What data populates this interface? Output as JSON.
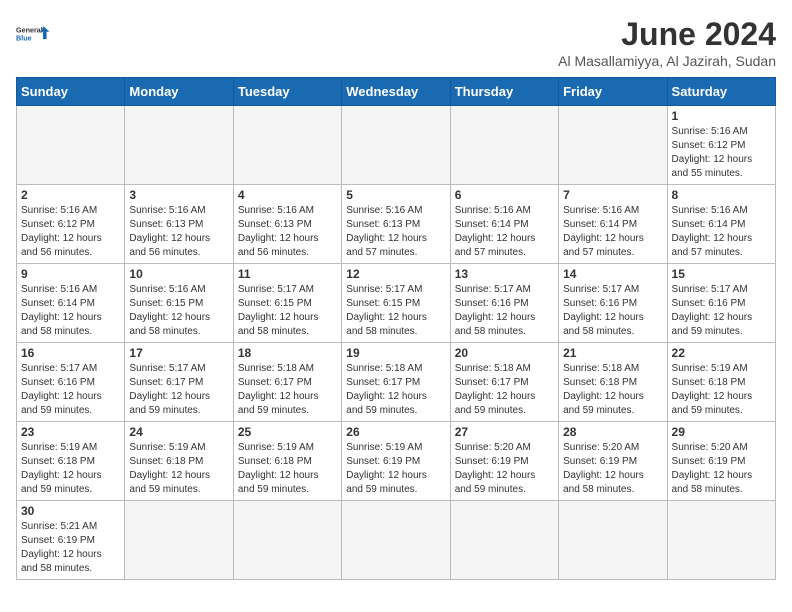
{
  "logo": {
    "line1": "General",
    "line2": "Blue"
  },
  "title": "June 2024",
  "subtitle": "Al Masallamiyya, Al Jazirah, Sudan",
  "weekdays": [
    "Sunday",
    "Monday",
    "Tuesday",
    "Wednesday",
    "Thursday",
    "Friday",
    "Saturday"
  ],
  "days": [
    {
      "date": 1,
      "col": 6,
      "sunrise": "5:16 AM",
      "sunset": "6:12 PM",
      "daylight": "12 hours and 55 minutes."
    },
    {
      "date": 2,
      "col": 0,
      "sunrise": "5:16 AM",
      "sunset": "6:12 PM",
      "daylight": "12 hours and 56 minutes."
    },
    {
      "date": 3,
      "col": 1,
      "sunrise": "5:16 AM",
      "sunset": "6:13 PM",
      "daylight": "12 hours and 56 minutes."
    },
    {
      "date": 4,
      "col": 2,
      "sunrise": "5:16 AM",
      "sunset": "6:13 PM",
      "daylight": "12 hours and 56 minutes."
    },
    {
      "date": 5,
      "col": 3,
      "sunrise": "5:16 AM",
      "sunset": "6:13 PM",
      "daylight": "12 hours and 57 minutes."
    },
    {
      "date": 6,
      "col": 4,
      "sunrise": "5:16 AM",
      "sunset": "6:14 PM",
      "daylight": "12 hours and 57 minutes."
    },
    {
      "date": 7,
      "col": 5,
      "sunrise": "5:16 AM",
      "sunset": "6:14 PM",
      "daylight": "12 hours and 57 minutes."
    },
    {
      "date": 8,
      "col": 6,
      "sunrise": "5:16 AM",
      "sunset": "6:14 PM",
      "daylight": "12 hours and 57 minutes."
    },
    {
      "date": 9,
      "col": 0,
      "sunrise": "5:16 AM",
      "sunset": "6:14 PM",
      "daylight": "12 hours and 58 minutes."
    },
    {
      "date": 10,
      "col": 1,
      "sunrise": "5:16 AM",
      "sunset": "6:15 PM",
      "daylight": "12 hours and 58 minutes."
    },
    {
      "date": 11,
      "col": 2,
      "sunrise": "5:17 AM",
      "sunset": "6:15 PM",
      "daylight": "12 hours and 58 minutes."
    },
    {
      "date": 12,
      "col": 3,
      "sunrise": "5:17 AM",
      "sunset": "6:15 PM",
      "daylight": "12 hours and 58 minutes."
    },
    {
      "date": 13,
      "col": 4,
      "sunrise": "5:17 AM",
      "sunset": "6:16 PM",
      "daylight": "12 hours and 58 minutes."
    },
    {
      "date": 14,
      "col": 5,
      "sunrise": "5:17 AM",
      "sunset": "6:16 PM",
      "daylight": "12 hours and 58 minutes."
    },
    {
      "date": 15,
      "col": 6,
      "sunrise": "5:17 AM",
      "sunset": "6:16 PM",
      "daylight": "12 hours and 59 minutes."
    },
    {
      "date": 16,
      "col": 0,
      "sunrise": "5:17 AM",
      "sunset": "6:16 PM",
      "daylight": "12 hours and 59 minutes."
    },
    {
      "date": 17,
      "col": 1,
      "sunrise": "5:17 AM",
      "sunset": "6:17 PM",
      "daylight": "12 hours and 59 minutes."
    },
    {
      "date": 18,
      "col": 2,
      "sunrise": "5:18 AM",
      "sunset": "6:17 PM",
      "daylight": "12 hours and 59 minutes."
    },
    {
      "date": 19,
      "col": 3,
      "sunrise": "5:18 AM",
      "sunset": "6:17 PM",
      "daylight": "12 hours and 59 minutes."
    },
    {
      "date": 20,
      "col": 4,
      "sunrise": "5:18 AM",
      "sunset": "6:17 PM",
      "daylight": "12 hours and 59 minutes."
    },
    {
      "date": 21,
      "col": 5,
      "sunrise": "5:18 AM",
      "sunset": "6:18 PM",
      "daylight": "12 hours and 59 minutes."
    },
    {
      "date": 22,
      "col": 6,
      "sunrise": "5:19 AM",
      "sunset": "6:18 PM",
      "daylight": "12 hours and 59 minutes."
    },
    {
      "date": 23,
      "col": 0,
      "sunrise": "5:19 AM",
      "sunset": "6:18 PM",
      "daylight": "12 hours and 59 minutes."
    },
    {
      "date": 24,
      "col": 1,
      "sunrise": "5:19 AM",
      "sunset": "6:18 PM",
      "daylight": "12 hours and 59 minutes."
    },
    {
      "date": 25,
      "col": 2,
      "sunrise": "5:19 AM",
      "sunset": "6:18 PM",
      "daylight": "12 hours and 59 minutes."
    },
    {
      "date": 26,
      "col": 3,
      "sunrise": "5:19 AM",
      "sunset": "6:19 PM",
      "daylight": "12 hours and 59 minutes."
    },
    {
      "date": 27,
      "col": 4,
      "sunrise": "5:20 AM",
      "sunset": "6:19 PM",
      "daylight": "12 hours and 59 minutes."
    },
    {
      "date": 28,
      "col": 5,
      "sunrise": "5:20 AM",
      "sunset": "6:19 PM",
      "daylight": "12 hours and 58 minutes."
    },
    {
      "date": 29,
      "col": 6,
      "sunrise": "5:20 AM",
      "sunset": "6:19 PM",
      "daylight": "12 hours and 58 minutes."
    },
    {
      "date": 30,
      "col": 0,
      "sunrise": "5:21 AM",
      "sunset": "6:19 PM",
      "daylight": "12 hours and 58 minutes."
    }
  ],
  "labels": {
    "sunrise": "Sunrise:",
    "sunset": "Sunset:",
    "daylight": "Daylight:"
  }
}
